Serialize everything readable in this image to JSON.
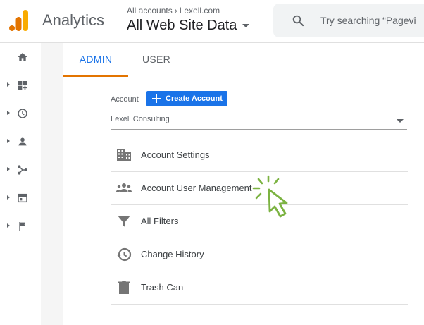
{
  "header": {
    "app_title": "Analytics",
    "breadcrumb": {
      "accounts": "All accounts",
      "account": "Lexell.com"
    },
    "view": "All Web Site Data",
    "search_placeholder": "Try searching “Pagevi"
  },
  "left_nav": {
    "items": [
      {
        "icon": "home-icon",
        "expandable": false
      },
      {
        "icon": "dashboard-icon",
        "expandable": true
      },
      {
        "icon": "clock-icon",
        "expandable": true
      },
      {
        "icon": "person-icon",
        "expandable": true
      },
      {
        "icon": "acquisition-icon",
        "expandable": true
      },
      {
        "icon": "behavior-icon",
        "expandable": true
      },
      {
        "icon": "flag-icon",
        "expandable": true
      }
    ]
  },
  "tabs": [
    {
      "label": "ADMIN",
      "active": true
    },
    {
      "label": "USER",
      "active": false
    }
  ],
  "account": {
    "label": "Account",
    "create_button": "Create Account",
    "selected": "Lexell Consulting"
  },
  "menu": [
    {
      "label": "Account Settings",
      "icon": "building-icon"
    },
    {
      "label": "Account User Management",
      "icon": "people-icon"
    },
    {
      "label": "All Filters",
      "icon": "filter-icon"
    },
    {
      "label": "Change History",
      "icon": "history-icon"
    },
    {
      "label": "Trash Can",
      "icon": "trash-icon"
    }
  ],
  "colors": {
    "accent": "#1a73e8",
    "tab_underline": "#e37400",
    "logo_orange": "#f9ab00",
    "logo_dark": "#e37400",
    "cursor_green": "#7cb342"
  }
}
